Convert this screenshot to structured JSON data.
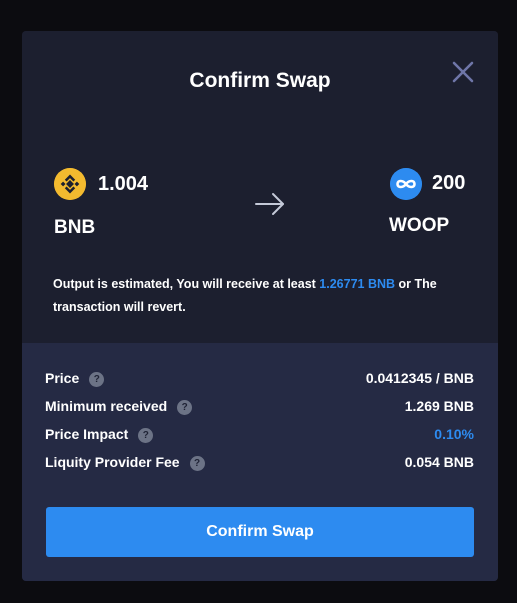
{
  "modal": {
    "title": "Confirm Swap",
    "close_icon": "close-icon"
  },
  "swap": {
    "from": {
      "amount": "1.004",
      "symbol": "BNB",
      "icon": "bnb-token-icon",
      "color": "#f3ba2f"
    },
    "to": {
      "amount": "200",
      "symbol": "WOOP",
      "icon": "woop-token-icon",
      "color": "#2d8bf0"
    },
    "arrow_icon": "arrow-right-icon"
  },
  "note": {
    "prefix": "Output is estimated, You will receive at least ",
    "highlight": "1.26771 BNB",
    "suffix": " or The transaction will revert."
  },
  "details": [
    {
      "label": "Price",
      "help": "?",
      "value": "0.0412345 / BNB"
    },
    {
      "label": "Minimum received",
      "help": "?",
      "value": "1.269 BNB"
    },
    {
      "label": "Price Impact",
      "help": "?",
      "value": "0.10%"
    },
    {
      "label": "Liquity Provider Fee",
      "help": "?",
      "value": "0.054 BNB"
    }
  ],
  "confirm_button": {
    "label": "Confirm Swap"
  },
  "colors": {
    "accent": "#2d8bf0",
    "panel": "#1c1f2f",
    "panel_alt": "#252a44",
    "background": "#0c0c10"
  }
}
